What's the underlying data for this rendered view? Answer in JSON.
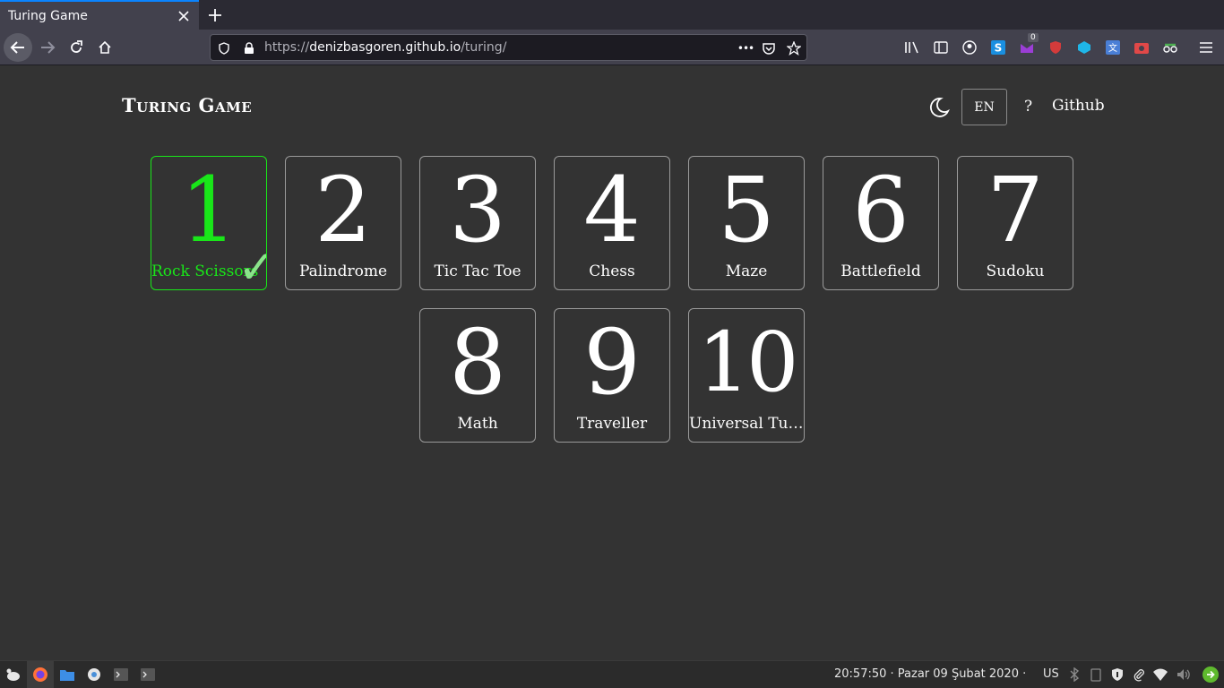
{
  "browser": {
    "tab_title": "Turing Game",
    "url_scheme": "https://",
    "url_host": "denizbasgoren.github.io",
    "url_path": "/turing/",
    "url_more": "•••",
    "ext_badge": "0"
  },
  "site": {
    "title": "Turing Game",
    "language": "EN",
    "help": "?",
    "github": "Github"
  },
  "levels": [
    {
      "number": "1",
      "name": "Rock Scissors"
    },
    {
      "number": "2",
      "name": "Palindrome"
    },
    {
      "number": "3",
      "name": "Tic Tac Toe"
    },
    {
      "number": "4",
      "name": "Chess"
    },
    {
      "number": "5",
      "name": "Maze"
    },
    {
      "number": "6",
      "name": "Battlefield"
    },
    {
      "number": "7",
      "name": "Sudoku"
    },
    {
      "number": "8",
      "name": "Math"
    },
    {
      "number": "9",
      "name": "Traveller"
    },
    {
      "number": "10",
      "name": "Universal Turing Machine"
    }
  ],
  "solved_check": "✓",
  "taskbar": {
    "clock": "20:57:50  ·  Pazar 09 Şubat 2020  ·",
    "keyboard": "US"
  },
  "colors": {
    "accent_solved": "#19e619",
    "background": "#333333"
  }
}
